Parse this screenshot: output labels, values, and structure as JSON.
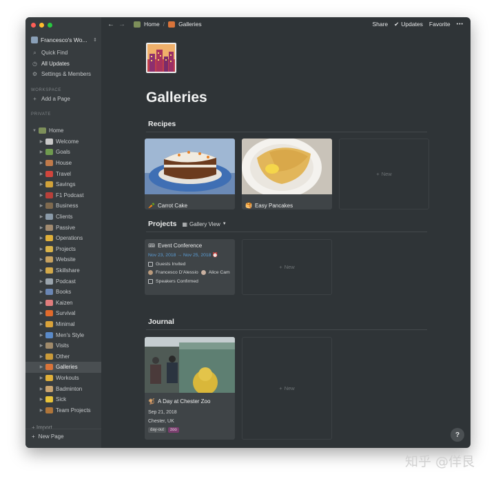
{
  "colors": {
    "close": "#fe5f57",
    "minimize": "#febc2e",
    "zoom": "#28c840",
    "link": "#5b9ed7"
  },
  "workspace": {
    "name": "Francesco's Wo...",
    "switch_icon": "chevron-updown-icon"
  },
  "sidebar": {
    "top_items": [
      {
        "icon": "search-icon",
        "glyph": "⌕",
        "label": "Quick Find"
      },
      {
        "icon": "clock-icon",
        "glyph": "◷",
        "label": "All Updates"
      },
      {
        "icon": "gear-icon",
        "glyph": "⚙",
        "label": "Settings & Members"
      }
    ],
    "workspace_label": "WORKSPACE",
    "add_page": "Add a Page",
    "private_label": "PRIVATE",
    "home": "Home",
    "pages": [
      {
        "label": "Welcome",
        "color": "#c9c9c9"
      },
      {
        "label": "Goals",
        "color": "#6f9a4f"
      },
      {
        "label": "House",
        "color": "#c07a4a"
      },
      {
        "label": "Travel",
        "color": "#d0453c"
      },
      {
        "label": "Savings",
        "color": "#d1a23a"
      },
      {
        "label": "F1 Podcast",
        "color": "#b8403a"
      },
      {
        "label": "Business",
        "color": "#7f6a4f"
      },
      {
        "label": "Clients",
        "color": "#8a9aa8"
      },
      {
        "label": "Passive",
        "color": "#a28b70"
      },
      {
        "label": "Operations",
        "color": "#e0b03a"
      },
      {
        "label": "Projects",
        "color": "#d9b34a"
      },
      {
        "label": "Website",
        "color": "#c7a260"
      },
      {
        "label": "Skillshare",
        "color": "#d3a94a"
      },
      {
        "label": "Podcast",
        "color": "#9aa4ad"
      },
      {
        "label": "Books",
        "color": "#6a86b4"
      },
      {
        "label": "Kaizen",
        "color": "#e07d7d"
      },
      {
        "label": "Survival",
        "color": "#e06a2c"
      },
      {
        "label": "Minimal",
        "color": "#d9a23a"
      },
      {
        "label": "Men's Style",
        "color": "#5a8ac8"
      },
      {
        "label": "Visits",
        "color": "#a08a6a"
      },
      {
        "label": "Other",
        "color": "#c99a3a"
      },
      {
        "label": "Galleries",
        "color": "#d9743a"
      },
      {
        "label": "Workouts",
        "color": "#e0b03a"
      },
      {
        "label": "Badminton",
        "color": "#c9a470"
      },
      {
        "label": "Sick",
        "color": "#e8c33a"
      },
      {
        "label": "Team Projects",
        "color": "#b0763a"
      }
    ],
    "import": "Import",
    "new_page": "New Page"
  },
  "topbar": {
    "back_glyph": "←",
    "forward_glyph": "→",
    "crumbs": [
      "Home",
      "Galleries"
    ],
    "share": "Share",
    "updates": "Updates",
    "favorite": "Favorite",
    "more": "•••"
  },
  "page": {
    "title": "Galleries",
    "recipes": {
      "heading": "Recipes",
      "cards": [
        {
          "emoji": "🥕",
          "title": "Carrot Cake"
        },
        {
          "emoji": "🥞",
          "title": "Easy Pancakes"
        }
      ],
      "new_label": "New"
    },
    "projects": {
      "heading": "Projects",
      "view": "Gallery View",
      "card": {
        "emoji": "🎟",
        "title": "Event Conference",
        "dates": "Nov 23, 2018 → Nov 25, 2018",
        "check1": "Guests Invited",
        "person1": "Francesco D'Alessio",
        "person2": "Alice Cam",
        "check2": "Speakers Confirmed"
      },
      "new_label": "New"
    },
    "journal": {
      "heading": "Journal",
      "card": {
        "emoji": "🐒",
        "title": "A Day at Chester Zoo",
        "date": "Sep 21, 2018",
        "location": "Chester, UK",
        "tags": [
          {
            "label": "day-out",
            "bg": "#55595c",
            "fg": "#d6d8d9"
          },
          {
            "label": "zoo",
            "bg": "#7a3f6e",
            "fg": "#f0d6ea"
          }
        ]
      },
      "new_label": "New"
    }
  },
  "help": "?",
  "watermark": "知乎 @佯艮"
}
